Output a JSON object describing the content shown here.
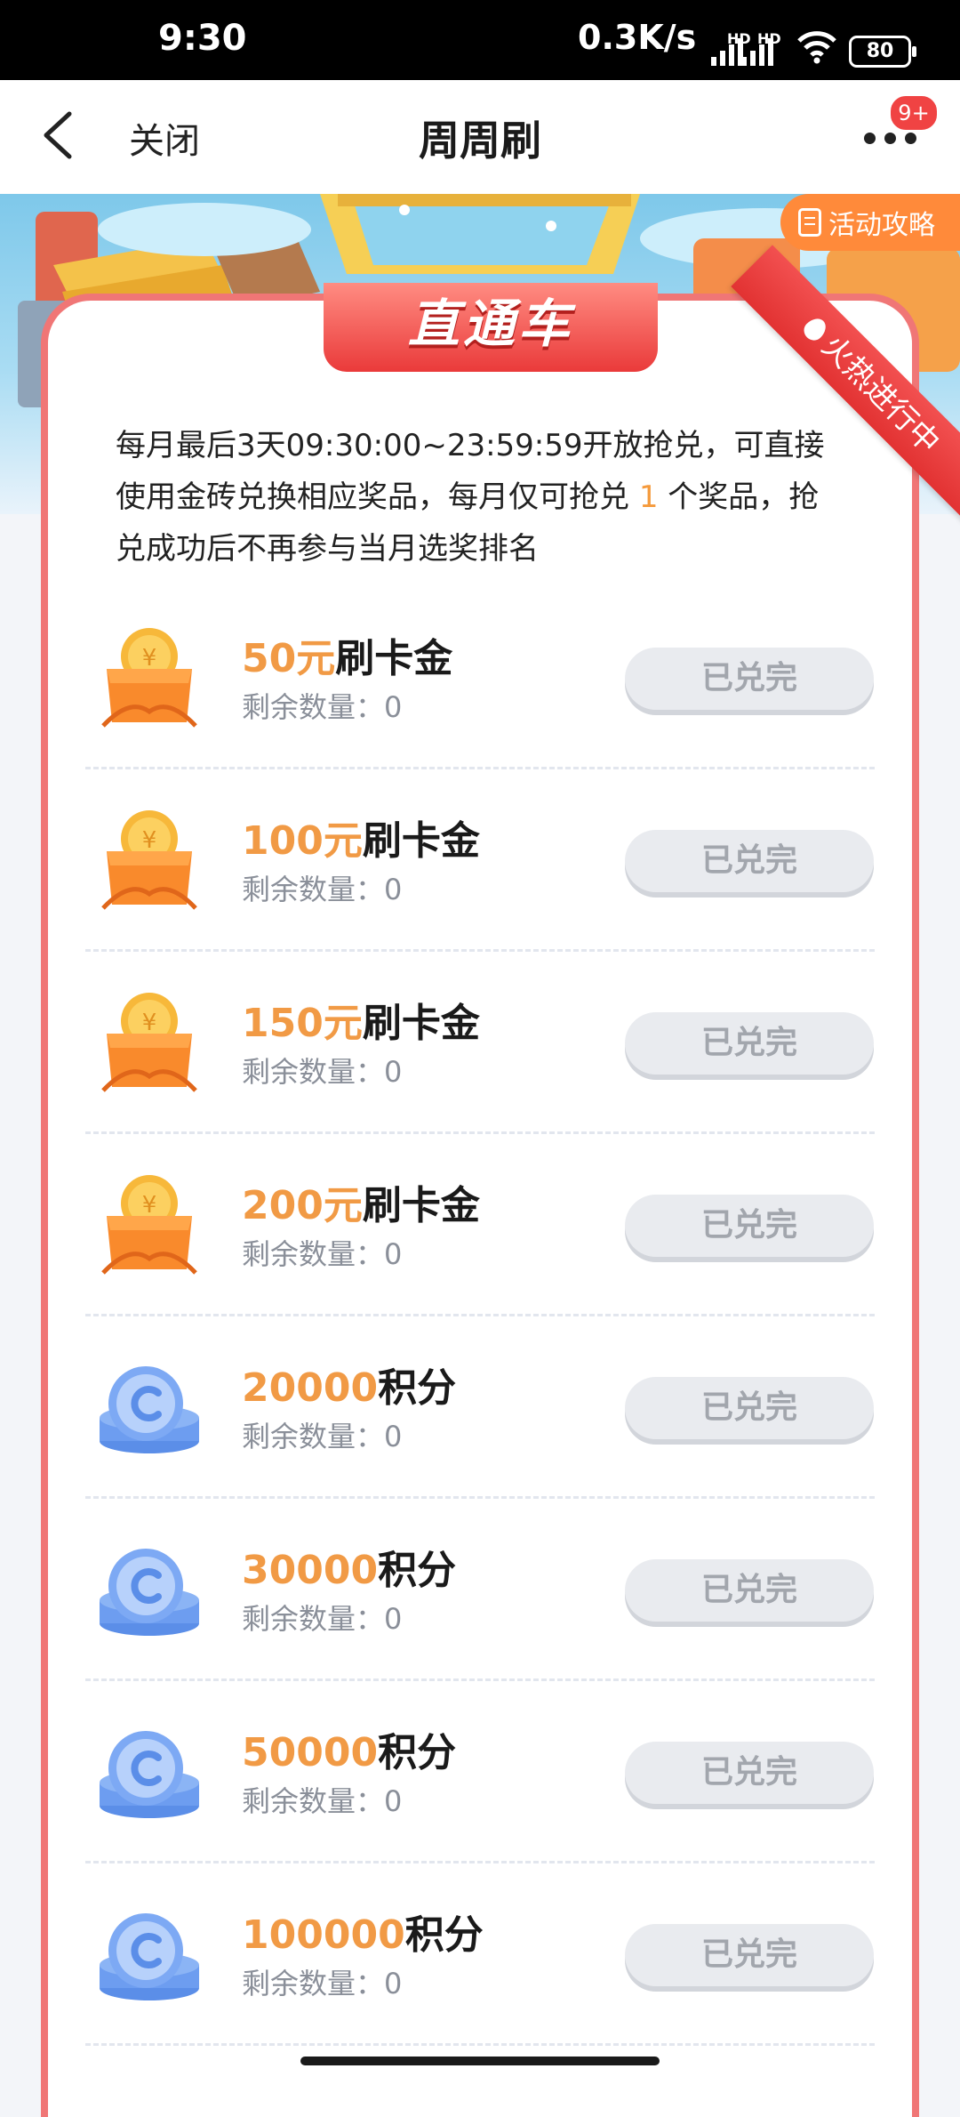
{
  "status_bar": {
    "time": "9:30",
    "network_speed": "0.3K/s",
    "hd_label": "HD",
    "battery": "80"
  },
  "header": {
    "close_label": "关闭",
    "title": "周周刷",
    "notification_badge": "9+"
  },
  "banner": {
    "strategy_label": "活动攻略"
  },
  "section": {
    "tab_label": "直通车",
    "ribbon_label": "火热进行中",
    "desc_part1": "每月最后3天09:30:00~23:59:59开放抢兑，可直接使用金砖兑换相应奖品，每月仅可抢兑 ",
    "desc_count": "1",
    "desc_part2": " 个奖品，抢兑成功后不再参与当月选奖排名"
  },
  "prizes": [
    {
      "amount": "50元",
      "unit": "刷卡金",
      "stock": "剩余数量：0",
      "button": "已兑完",
      "icon": "gift-box-coin-icon"
    },
    {
      "amount": "100元",
      "unit": "刷卡金",
      "stock": "剩余数量：0",
      "button": "已兑完",
      "icon": "gift-box-coin-icon"
    },
    {
      "amount": "150元",
      "unit": "刷卡金",
      "stock": "剩余数量：0",
      "button": "已兑完",
      "icon": "gift-box-coin-icon"
    },
    {
      "amount": "200元",
      "unit": "刷卡金",
      "stock": "剩余数量：0",
      "button": "已兑完",
      "icon": "gift-box-coin-icon"
    },
    {
      "amount": "20000",
      "unit": "积分",
      "stock": "剩余数量：0",
      "button": "已兑完",
      "icon": "points-coin-stack-icon"
    },
    {
      "amount": "30000",
      "unit": "积分",
      "stock": "剩余数量：0",
      "button": "已兑完",
      "icon": "points-coin-stack-icon"
    },
    {
      "amount": "50000",
      "unit": "积分",
      "stock": "剩余数量：0",
      "button": "已兑完",
      "icon": "points-coin-stack-icon"
    },
    {
      "amount": "100000",
      "unit": "积分",
      "stock": "剩余数量：0",
      "button": "已兑完",
      "icon": "points-coin-stack-icon"
    }
  ],
  "colors": {
    "accent_orange": "#f19a45",
    "card_border": "#f07676",
    "ribbon_red": "#e23232",
    "disabled_gray": "#e9ebef"
  }
}
